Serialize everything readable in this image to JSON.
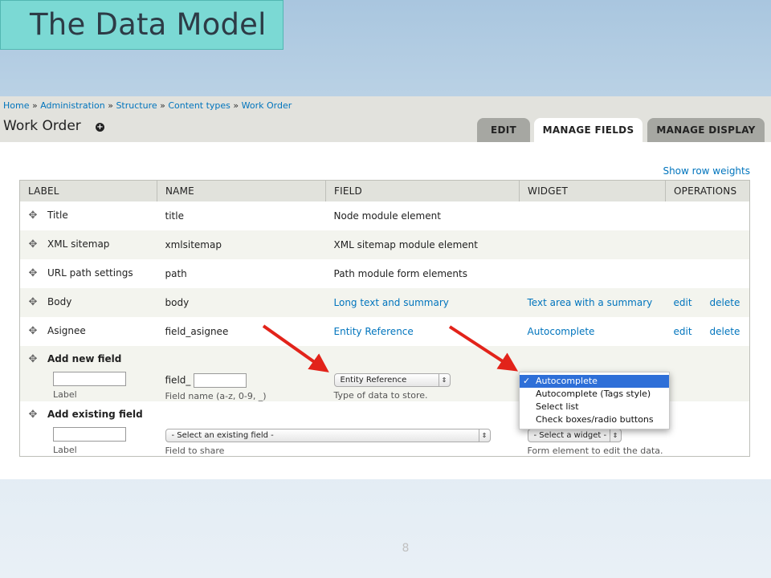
{
  "slide": {
    "title": "The Data Model",
    "page_number": "8"
  },
  "breadcrumb": [
    "Home",
    "Administration",
    "Structure",
    "Content types",
    "Work Order"
  ],
  "breadcrumb_separator": "»",
  "page_title": "Work Order",
  "tabs": [
    {
      "label": "EDIT",
      "active": false
    },
    {
      "label": "MANAGE FIELDS",
      "active": true
    },
    {
      "label": "MANAGE DISPLAY",
      "active": false
    }
  ],
  "show_row_weights": "Show row weights",
  "columns": [
    "LABEL",
    "NAME",
    "FIELD",
    "WIDGET",
    "OPERATIONS"
  ],
  "rows": [
    {
      "label": "Title",
      "name": "title",
      "field": "Node module element",
      "field_link": false,
      "widget": "",
      "edit": "",
      "delete": ""
    },
    {
      "label": "XML sitemap",
      "name": "xmlsitemap",
      "field": "XML sitemap module element",
      "field_link": false,
      "widget": "",
      "edit": "",
      "delete": ""
    },
    {
      "label": "URL path settings",
      "name": "path",
      "field": "Path module form elements",
      "field_link": false,
      "widget": "",
      "edit": "",
      "delete": ""
    },
    {
      "label": "Body",
      "name": "body",
      "field": "Long text and summary",
      "field_link": true,
      "widget": "Text area with a summary",
      "edit": "edit",
      "delete": "delete"
    },
    {
      "label": "Asignee",
      "name": "field_asignee",
      "field": "Entity Reference",
      "field_link": true,
      "widget": "Autocomplete",
      "edit": "edit",
      "delete": "delete"
    }
  ],
  "add_new_field": {
    "title": "Add new field",
    "label_input_value": "",
    "label_desc": "Label",
    "name_prefix": "field_",
    "name_input_value": "",
    "name_desc": "Field name (a-z, 0-9, _)",
    "type_select": "Entity Reference",
    "type_desc": "Type of data to store."
  },
  "widget_dropdown": {
    "options": [
      "Autocomplete",
      "Autocomplete (Tags style)",
      "Select list",
      "Check boxes/radio buttons"
    ],
    "selected": "Autocomplete",
    "check": "✓"
  },
  "add_existing_field": {
    "title": "Add existing field",
    "label_input_value": "",
    "label_desc": "Label",
    "field_select": "- Select an existing field -",
    "field_desc": "Field to share",
    "widget_select": "- Select a widget -",
    "widget_desc": "Form element to edit the data."
  },
  "colors": {
    "link": "#0074bd",
    "title_box": "#7bd9d4",
    "arrow": "#e2231a",
    "selected_option": "#2e6fd8"
  },
  "icons": {
    "drag": "move-cross-icon",
    "add": "plus-circle-icon",
    "arrow": "red-arrow-icon"
  }
}
